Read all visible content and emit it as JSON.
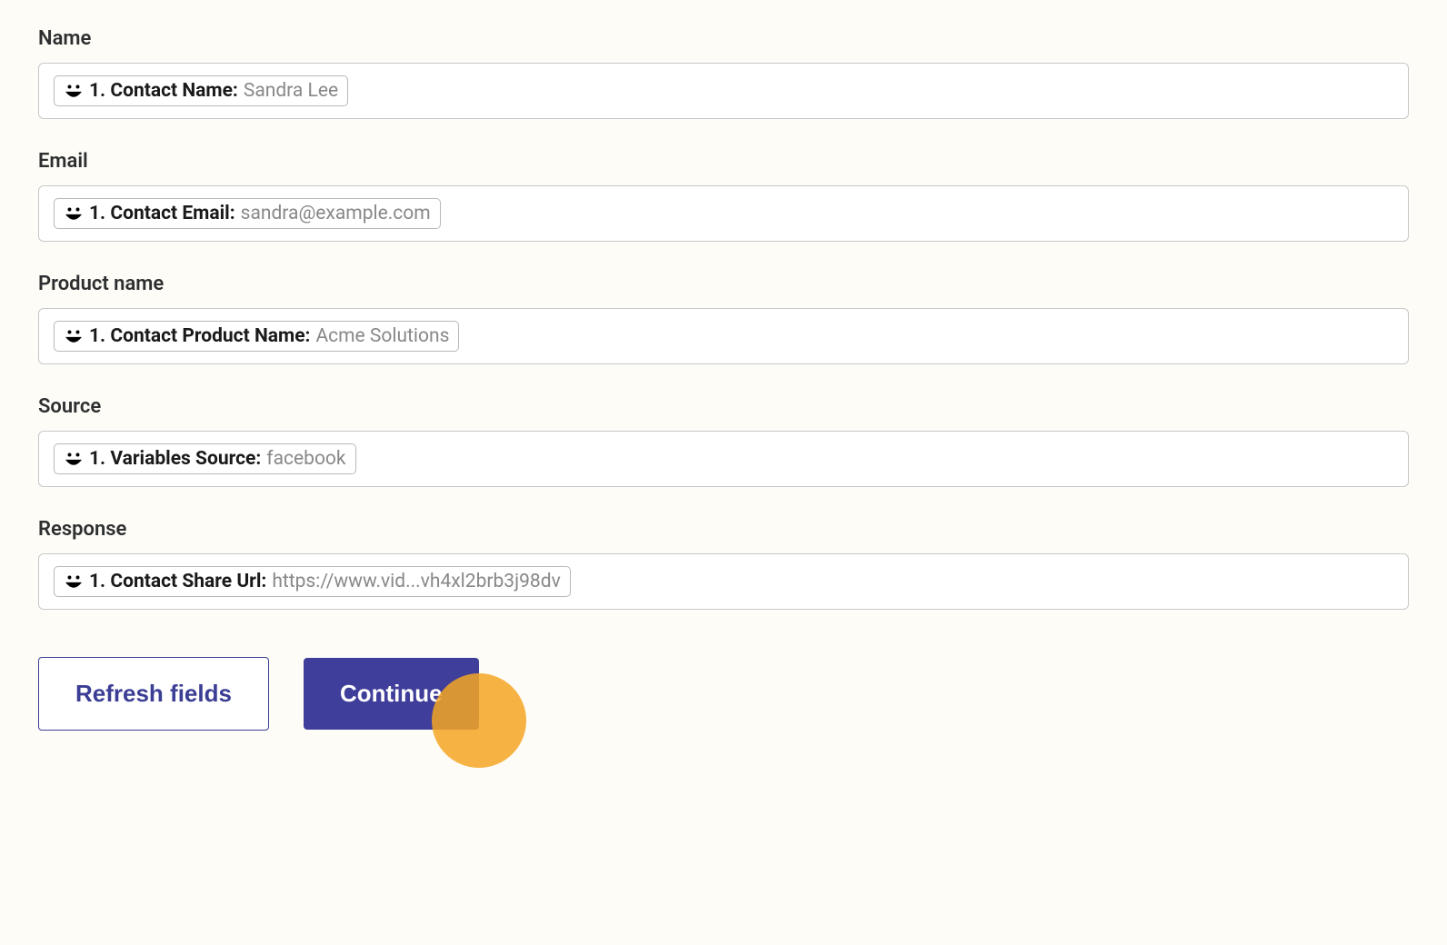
{
  "fields": [
    {
      "label": "Name",
      "pill_label": "1. Contact Name:",
      "pill_value": "Sandra Lee"
    },
    {
      "label": "Email",
      "pill_label": "1. Contact Email:",
      "pill_value": "sandra@example.com"
    },
    {
      "label": "Product name",
      "pill_label": "1. Contact Product Name:",
      "pill_value": "Acme Solutions"
    },
    {
      "label": "Source",
      "pill_label": "1. Variables Source:",
      "pill_value": "facebook"
    },
    {
      "label": "Response",
      "pill_label": "1. Contact Share Url:",
      "pill_value": "https://www.vid...vh4xl2brb3j98dv"
    }
  ],
  "buttons": {
    "refresh": "Refresh fields",
    "continue": "Continue"
  }
}
